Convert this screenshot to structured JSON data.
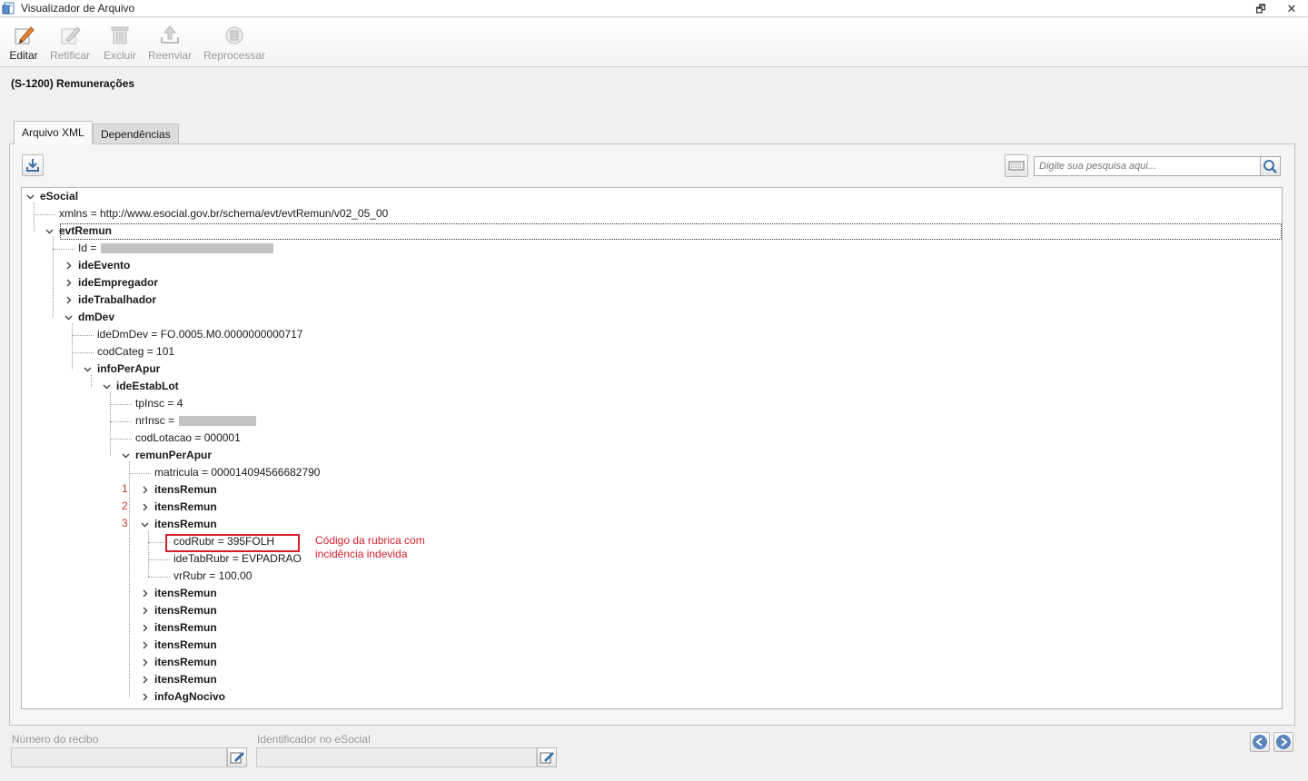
{
  "window": {
    "title": "Visualizador de Arquivo",
    "restore": "🗗",
    "close": "✕"
  },
  "toolbar": {
    "edit_label": "Editar",
    "rectify_label": "Retificar",
    "delete_label": "Excluir",
    "resend_label": "Reenviar",
    "reprocess_label": "Reprocessar"
  },
  "page": {
    "title": "(S-1200) Remunerações"
  },
  "tabs": [
    {
      "label": "Arquivo XML",
      "active": true
    },
    {
      "label": "Dependências",
      "active": false
    }
  ],
  "search": {
    "placeholder": "Digite sua pesquisa aqui..."
  },
  "tree": {
    "nodes": [
      {
        "text": "eSocial",
        "bold": true,
        "expanded": true
      },
      {
        "text": "xmlns = http://www.esocial.gov.br/schema/evt/evtRemun/v02_05_00"
      },
      {
        "text": "evtRemun",
        "bold": true,
        "expanded": true
      },
      {
        "text": "Id ="
      },
      {
        "text": "ideEvento",
        "bold": true,
        "expanded": false
      },
      {
        "text": "ideEmpregador",
        "bold": true,
        "expanded": false
      },
      {
        "text": "ideTrabalhador",
        "bold": true,
        "expanded": false
      },
      {
        "text": "dmDev",
        "bold": true,
        "expanded": true
      },
      {
        "text": "ideDmDev = FO.0005.M0.0000000000717"
      },
      {
        "text": "codCateg = 101"
      },
      {
        "text": "infoPerApur",
        "bold": true,
        "expanded": true
      },
      {
        "text": "ideEstabLot",
        "bold": true,
        "expanded": true
      },
      {
        "text": "tpInsc = 4"
      },
      {
        "text": "nrInsc ="
      },
      {
        "text": "codLotacao = 000001"
      },
      {
        "text": "remunPerApur",
        "bold": true,
        "expanded": true
      },
      {
        "text": "matricula = 000014094566682790"
      },
      {
        "text": "itensRemun",
        "bold": true,
        "expanded": false
      },
      {
        "text": "itensRemun",
        "bold": true,
        "expanded": false
      },
      {
        "text": "itensRemun",
        "bold": true,
        "expanded": true
      },
      {
        "text": "codRubr = 395FOLH"
      },
      {
        "text": "ideTabRubr = EVPADRAO"
      },
      {
        "text": "vrRubr = 100.00"
      },
      {
        "text": "itensRemun",
        "bold": true,
        "expanded": false
      },
      {
        "text": "itensRemun",
        "bold": true,
        "expanded": false
      },
      {
        "text": "itensRemun",
        "bold": true,
        "expanded": false
      },
      {
        "text": "itensRemun",
        "bold": true,
        "expanded": false
      },
      {
        "text": "itensRemun",
        "bold": true,
        "expanded": false
      },
      {
        "text": "itensRemun",
        "bold": true,
        "expanded": false
      },
      {
        "text": "infoAgNocivo",
        "bold": true,
        "expanded": false
      }
    ],
    "markers": [
      "1",
      "2",
      "3"
    ],
    "annotation": "Código da rubrica com incidência indevida"
  },
  "footer": {
    "receipt_label": "Número do recibo",
    "receipt_value": "",
    "esocial_id_label": "Identificador no eSocial",
    "esocial_id_value": ""
  },
  "colors": {
    "annotation": "#d21f2b",
    "accent": "#3b6ea5"
  }
}
